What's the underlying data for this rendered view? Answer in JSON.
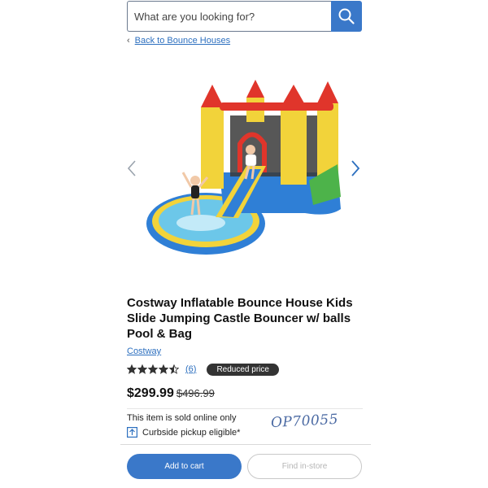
{
  "search": {
    "placeholder": "What are you looking for?"
  },
  "nav": {
    "back_label": "Back to Bounce Houses",
    "back_chevron": "‹"
  },
  "product": {
    "title": "Costway Inflatable Bounce House Kids Slide Jumping Castle Bouncer w/ balls Pool & Bag",
    "brand": "Costway",
    "rating": 4.5,
    "rating_max": 5,
    "review_count": "(6)",
    "badge": "Reduced price",
    "price": "$299.99",
    "old_price": "$496.99",
    "online_only": "This item is sold online only",
    "curbside": "Curbside pickup eligible*"
  },
  "annotation": {
    "handwritten": "OP70055"
  },
  "actions": {
    "add_to_cart": "Add to cart",
    "find_in_store": "Find in-store"
  },
  "colors": {
    "accent": "#3a78c9",
    "link": "#2c6fbf",
    "badge_bg": "#333333",
    "handwriting": "#4b6aa3"
  },
  "icons": [
    "search-icon",
    "chevron-left-icon",
    "chevron-right-icon",
    "star-icon",
    "store-pickup-icon"
  ]
}
